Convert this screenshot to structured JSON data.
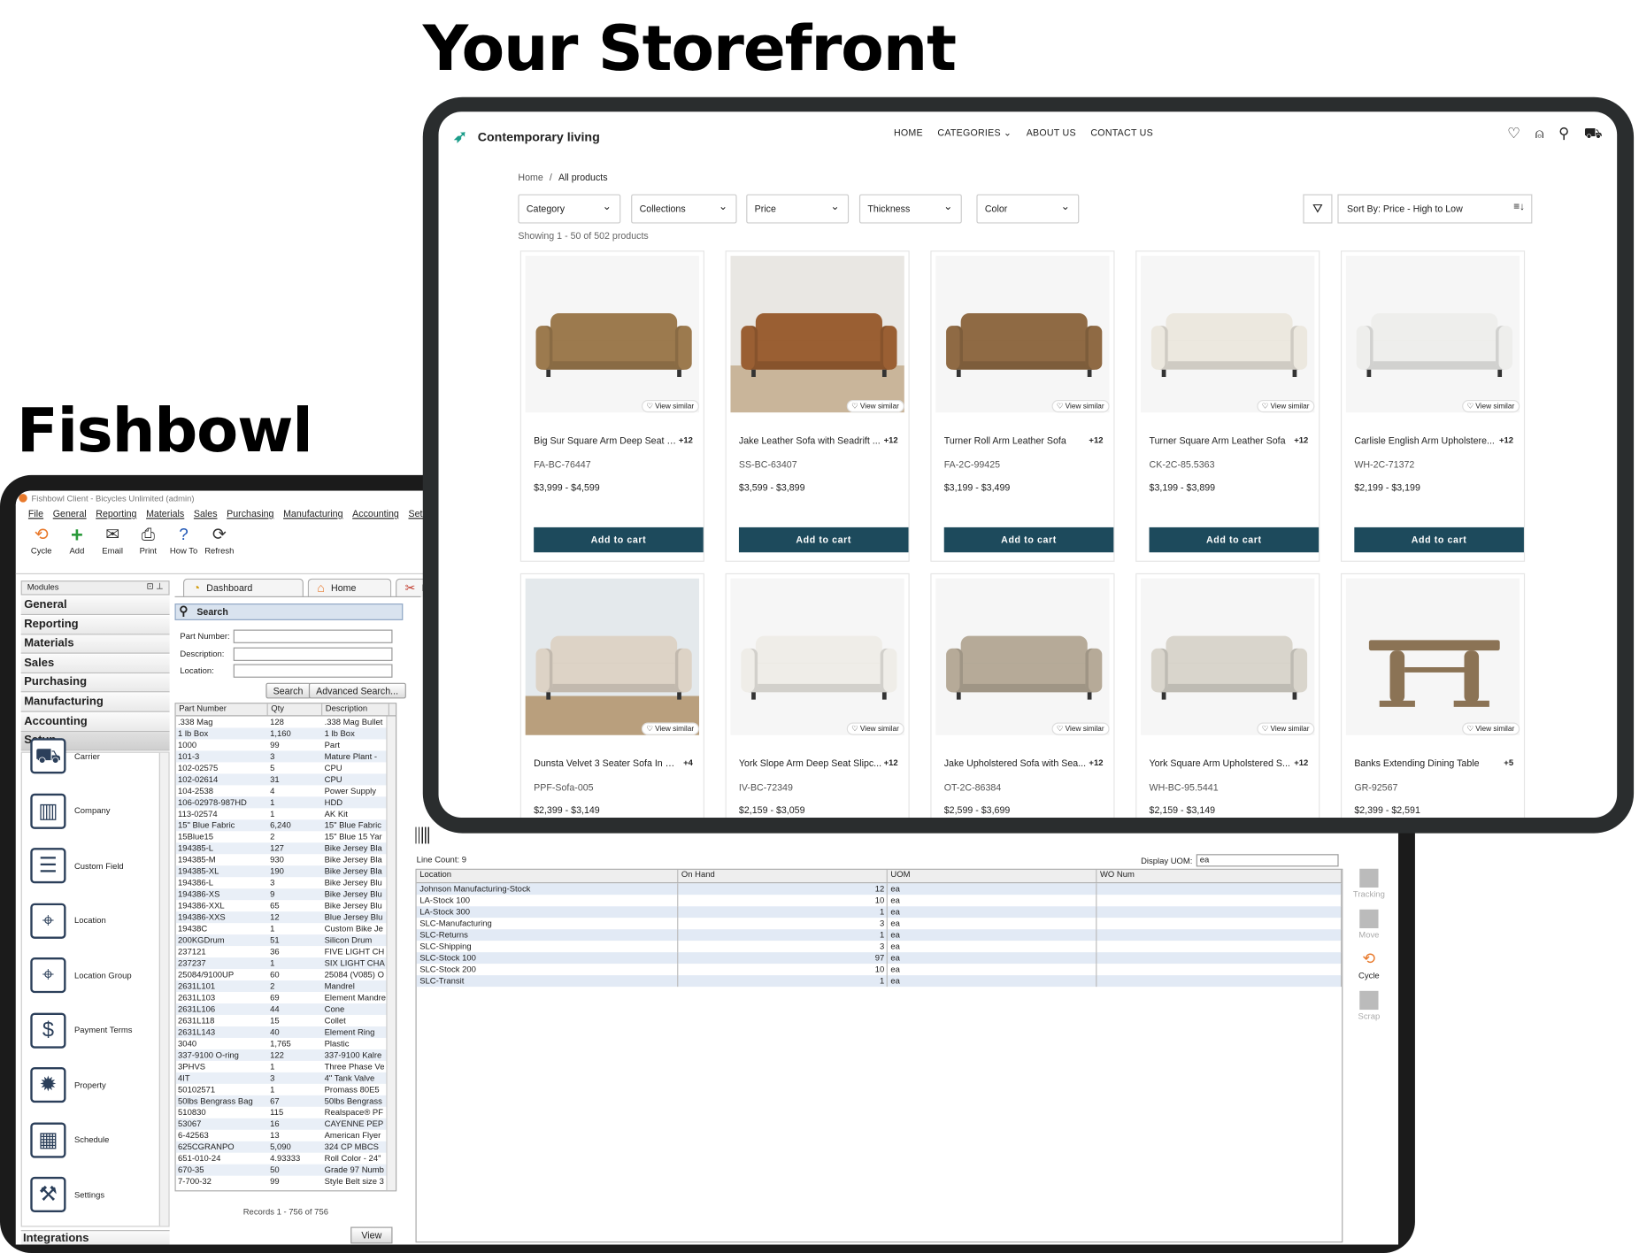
{
  "headlines": {
    "storefront": "Your Storefront",
    "fishbowl": "Fishbowl"
  },
  "fishbowl": {
    "title": "Fishbowl Client - Bicycles Unlimited (admin)",
    "menu": [
      "File",
      "General",
      "Reporting",
      "Materials",
      "Sales",
      "Purchasing",
      "Manufacturing",
      "Accounting",
      "Setup"
    ],
    "toolbar": [
      {
        "label": "Cycle",
        "icon": "cycle-icon"
      },
      {
        "label": "Add",
        "icon": "add-icon"
      },
      {
        "label": "Email",
        "icon": "email-icon"
      },
      {
        "label": "Print",
        "icon": "print-icon"
      },
      {
        "label": "How To",
        "icon": "help-icon"
      },
      {
        "label": "Refresh",
        "icon": "refresh-icon"
      }
    ],
    "modules_label": "Modules",
    "module_categories": [
      "General",
      "Reporting",
      "Materials",
      "Sales",
      "Purchasing",
      "Manufacturing",
      "Accounting",
      "Setup"
    ],
    "selected_category": "Setup",
    "setup_items": [
      {
        "label": "Carrier",
        "icon": "carrier-icon"
      },
      {
        "label": "Company",
        "icon": "company-icon"
      },
      {
        "label": "Custom Field",
        "icon": "custom-field-icon"
      },
      {
        "label": "Location",
        "icon": "location-icon"
      },
      {
        "label": "Location Group",
        "icon": "location-group-icon"
      },
      {
        "label": "Payment Terms",
        "icon": "payment-terms-icon"
      },
      {
        "label": "Property",
        "icon": "property-icon"
      },
      {
        "label": "Schedule",
        "icon": "schedule-icon"
      },
      {
        "label": "Settings",
        "icon": "settings-icon"
      }
    ],
    "integrations_label": "Integrations",
    "tabs": [
      {
        "label": "Dashboard",
        "icon": "dashboard-icon"
      },
      {
        "label": "Home",
        "icon": "home-icon"
      },
      {
        "label": "Pa",
        "icon": "tools-icon"
      }
    ],
    "search": {
      "title": "Search",
      "part_number_label": "Part Number:",
      "description_label": "Description:",
      "location_label": "Location:",
      "search_button": "Search",
      "advanced_button": "Advanced Search..."
    },
    "parts_columns": [
      "Part Number",
      "Qty",
      "Description"
    ],
    "parts": [
      [
        ".338 Mag",
        "128",
        ".338 Mag Bullet"
      ],
      [
        "1 lb Box",
        "1,160",
        "1 lb Box"
      ],
      [
        "1000",
        "99",
        "Part"
      ],
      [
        "101-3",
        "3",
        "Mature Plant -"
      ],
      [
        "102-02575",
        "5",
        "CPU"
      ],
      [
        "102-02614",
        "31",
        "CPU"
      ],
      [
        "104-2538",
        "4",
        "Power Supply"
      ],
      [
        "106-02978-987HD",
        "1",
        "HDD"
      ],
      [
        "113-02574",
        "1",
        "AK Kit"
      ],
      [
        "15\" Blue Fabric",
        "6,240",
        "15\" Blue Fabric"
      ],
      [
        "15Blue15",
        "2",
        "15\" Blue 15 Yar"
      ],
      [
        "194385-L",
        "127",
        "Bike Jersey Bla"
      ],
      [
        "194385-M",
        "930",
        "Bike Jersey Bla"
      ],
      [
        "194385-XL",
        "190",
        "Bike Jersey Bla"
      ],
      [
        "194386-L",
        "3",
        "Bike Jersey Blu"
      ],
      [
        "194386-XS",
        "9",
        "Bike Jersey Blu"
      ],
      [
        "194386-XXL",
        "65",
        "Bike Jersey Blu"
      ],
      [
        "194386-XXS",
        "12",
        "Blue Jersey Blu"
      ],
      [
        "19438C",
        "1",
        "Custom Bike Je"
      ],
      [
        "200KGDrum",
        "51",
        "Silicon Drum"
      ],
      [
        "237121",
        "36",
        "FIVE LIGHT CH"
      ],
      [
        "237237",
        "1",
        "SIX LIGHT CHA"
      ],
      [
        "25084/9100UP",
        "60",
        "25084 (V085) O"
      ],
      [
        "2631L101",
        "2",
        "Mandrel"
      ],
      [
        "2631L103",
        "69",
        "Element Mandre"
      ],
      [
        "2631L106",
        "44",
        "Cone"
      ],
      [
        "2631L118",
        "15",
        "Collet"
      ],
      [
        "2631L143",
        "40",
        "Element Ring"
      ],
      [
        "3040",
        "1,765",
        "Plastic"
      ],
      [
        "337-9100 O-ring",
        "122",
        "337-9100 Kalre"
      ],
      [
        "3PHVS",
        "1",
        "Three Phase Ve"
      ],
      [
        "4IT",
        "3",
        "4\" Tank Valve"
      ],
      [
        "50102571",
        "1",
        "Promass 80E5"
      ],
      [
        "50lbs Bengrass Bag",
        "67",
        "50lbs Bengrass"
      ],
      [
        "510830",
        "115",
        "Realspace® PF"
      ],
      [
        "53067",
        "16",
        "CAYENNE PEP"
      ],
      [
        "6-42563",
        "13",
        "American Flyer"
      ],
      [
        "625CGRANPO",
        "5,090",
        "324 CP MBCS"
      ],
      [
        "651-010-24",
        "4.93333",
        "Roll Color - 24\""
      ],
      [
        "670-35",
        "50",
        "Grade 97 Numb"
      ],
      [
        "7-700-32",
        "99",
        "Style Belt size 3"
      ]
    ],
    "records_label": "Records 1 - 756 of 756",
    "view_button": "View",
    "line_count": "Line Count: 9",
    "display_uom_label": "Display UOM:",
    "display_uom_value": "ea",
    "loc_columns": [
      "Location",
      "On Hand",
      "UOM",
      "WO Num"
    ],
    "locations": [
      [
        "Johnson Manufacturing-Stock",
        "12",
        "ea"
      ],
      [
        "LA-Stock 100",
        "10",
        "ea"
      ],
      [
        "LA-Stock 300",
        "1",
        "ea"
      ],
      [
        "SLC-Manufacturing",
        "3",
        "ea"
      ],
      [
        "SLC-Returns",
        "1",
        "ea"
      ],
      [
        "SLC-Shipping",
        "3",
        "ea"
      ],
      [
        "SLC-Stock 100",
        "97",
        "ea"
      ],
      [
        "SLC-Stock 200",
        "10",
        "ea"
      ],
      [
        "SLC-Transit",
        "1",
        "ea"
      ]
    ],
    "side_actions": [
      {
        "label": "Tracking",
        "active": false
      },
      {
        "label": "Move",
        "active": false
      },
      {
        "label": "Cycle",
        "active": true
      },
      {
        "label": "Scrap",
        "active": false
      }
    ]
  },
  "store": {
    "brand": "Contemporary living",
    "nav": [
      "HOME",
      "CATEGORIES",
      "ABOUT US",
      "CONTACT US"
    ],
    "breadcrumb": {
      "home": "Home",
      "sep": "/",
      "current": "All products"
    },
    "filters": [
      "Category",
      "Collections",
      "Price",
      "Thickness",
      "Color"
    ],
    "sort": "Sort By: Price - High to Low",
    "showing": "Showing 1 - 50 of 502 products",
    "view_similar": "View similar",
    "add_to_cart": "Add to cart",
    "products": [
      {
        "name": "Big Sur Square Arm Deep Seat L...",
        "plus": "+12",
        "sku": "FA-BC-76447",
        "price": "$3,999 - $4,599",
        "color": "#9c7a4e"
      },
      {
        "name": "Jake Leather Sofa with Seadrift ...",
        "plus": "+12",
        "sku": "SS-BC-63407",
        "price": "$3,599 - $3,899",
        "color": "#9a5f33"
      },
      {
        "name": "Turner Roll Arm Leather Sofa",
        "plus": "+12",
        "sku": "FA-2C-99425",
        "price": "$3,199 - $3,499",
        "color": "#8f6a44"
      },
      {
        "name": "Turner Square Arm Leather Sofa",
        "plus": "+12",
        "sku": "CK-2C-85.5363",
        "price": "$3,199 - $3,899",
        "color": "#ece8df"
      },
      {
        "name": "Carlisle English Arm Upholstere...",
        "plus": "+12",
        "sku": "WH-2C-71372",
        "price": "$2,199 - $3,199",
        "color": "#eeeeec"
      },
      {
        "name": "Dunsta Velvet 3 Seater Sofa In C...",
        "plus": "+4",
        "sku": "PPF-Sofa-005",
        "price": "$2,399 - $3,149",
        "color": "#ddd3c6"
      },
      {
        "name": "York Slope Arm Deep Seat Slipc...",
        "plus": "+12",
        "sku": "IV-BC-72349",
        "price": "$2,159 - $3,059",
        "color": "#efede8"
      },
      {
        "name": "Jake Upholstered Sofa with Sea...",
        "plus": "+12",
        "sku": "OT-2C-86384",
        "price": "$2,599 - $3,699",
        "color": "#b6aa98"
      },
      {
        "name": "York Square Arm Upholstered S...",
        "plus": "+12",
        "sku": "WH-BC-95.5441",
        "price": "$2,159 - $3,149",
        "color": "#d9d5cc"
      },
      {
        "name": "Banks Extending Dining Table",
        "plus": "+5",
        "sku": "GR-92567",
        "price": "$2,399 - $2,591",
        "color": "#8b7355"
      }
    ]
  }
}
